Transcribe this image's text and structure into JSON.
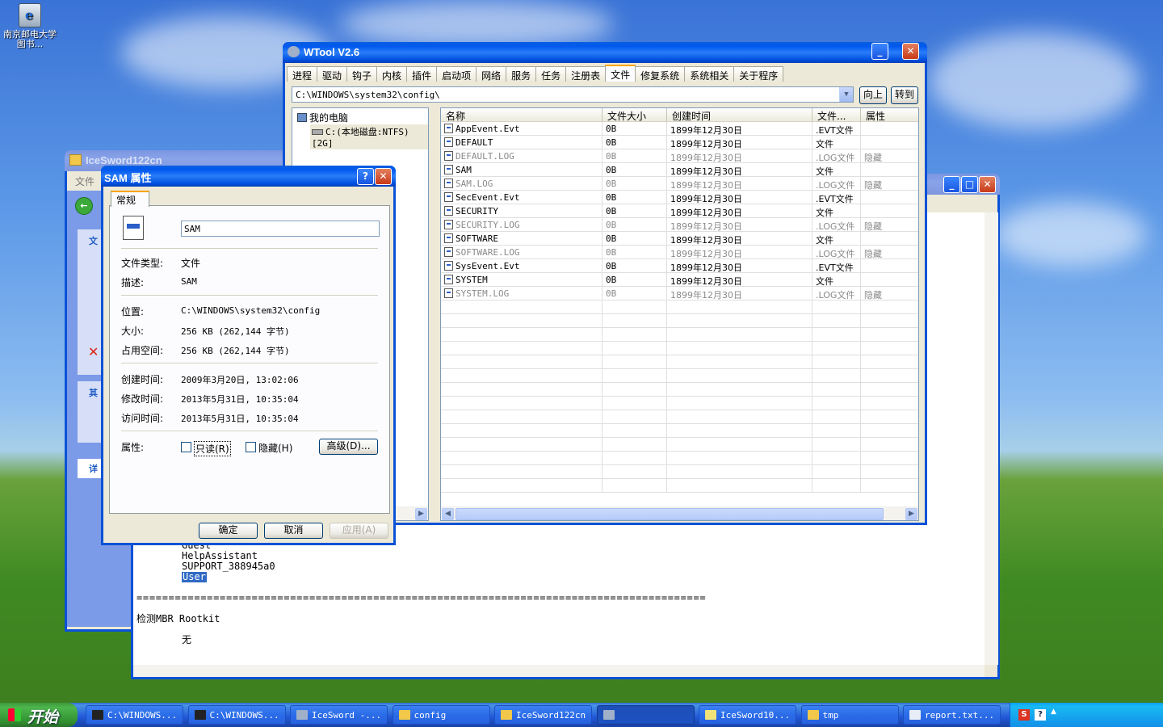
{
  "desktop": {
    "icon_label": "南京邮电大学图书..."
  },
  "wtool": {
    "title": "WTool V2.6",
    "tabs": [
      "进程",
      "驱动",
      "钩子",
      "内核",
      "插件",
      "启动项",
      "网络",
      "服务",
      "任务",
      "注册表",
      "文件",
      "修复系统",
      "系统相关",
      "关于程序"
    ],
    "selected_tab": "文件",
    "path": "C:\\WINDOWS\\system32\\config\\",
    "up_button": "向上",
    "goto_button": "转到",
    "tree": {
      "root": "我的电脑",
      "child": "C:(本地磁盘:NTFS)[2G]"
    },
    "columns": [
      "名称",
      "文件大小",
      "创建时间",
      "文件...",
      "属性"
    ],
    "files": [
      {
        "name": "AppEvent.Evt",
        "size": "0B",
        "created": "1899年12月30日",
        "type": ".EVT文件",
        "attr": "",
        "hidden": false
      },
      {
        "name": "DEFAULT",
        "size": "0B",
        "created": "1899年12月30日",
        "type": "文件",
        "attr": "",
        "hidden": false
      },
      {
        "name": "DEFAULT.LOG",
        "size": "0B",
        "created": "1899年12月30日",
        "type": ".LOG文件",
        "attr": "隐藏",
        "hidden": true
      },
      {
        "name": "SAM",
        "size": "0B",
        "created": "1899年12月30日",
        "type": "文件",
        "attr": "",
        "hidden": false
      },
      {
        "name": "SAM.LOG",
        "size": "0B",
        "created": "1899年12月30日",
        "type": ".LOG文件",
        "attr": "隐藏",
        "hidden": true
      },
      {
        "name": "SecEvent.Evt",
        "size": "0B",
        "created": "1899年12月30日",
        "type": ".EVT文件",
        "attr": "",
        "hidden": false
      },
      {
        "name": "SECURITY",
        "size": "0B",
        "created": "1899年12月30日",
        "type": "文件",
        "attr": "",
        "hidden": false
      },
      {
        "name": "SECURITY.LOG",
        "size": "0B",
        "created": "1899年12月30日",
        "type": ".LOG文件",
        "attr": "隐藏",
        "hidden": true
      },
      {
        "name": "SOFTWARE",
        "size": "0B",
        "created": "1899年12月30日",
        "type": "文件",
        "attr": "",
        "hidden": false
      },
      {
        "name": "SOFTWARE.LOG",
        "size": "0B",
        "created": "1899年12月30日",
        "type": ".LOG文件",
        "attr": "隐藏",
        "hidden": true
      },
      {
        "name": "SysEvent.Evt",
        "size": "0B",
        "created": "1899年12月30日",
        "type": ".EVT文件",
        "attr": "",
        "hidden": false
      },
      {
        "name": "SYSTEM",
        "size": "0B",
        "created": "1899年12月30日",
        "type": "文件",
        "attr": "",
        "hidden": false
      },
      {
        "name": "SYSTEM.LOG",
        "size": "0B",
        "created": "1899年12月30日",
        "type": ".LOG文件",
        "attr": "隐藏",
        "hidden": true
      }
    ]
  },
  "icesword": {
    "title": "IceSword122cn",
    "menu_partial": "文件",
    "section1": "文",
    "section2": "其",
    "section3": "详"
  },
  "notepad": {
    "lines": [
      "Guest",
      "HelpAssistant",
      "SUPPORT_388945a0"
    ],
    "selected": "User",
    "separator": "=========================================================================================",
    "heading": "检测MBR Rootkit",
    "result": "无"
  },
  "dialog": {
    "title": "SAM 属性",
    "tab": "常规",
    "filename": "SAM",
    "rows": [
      {
        "label": "文件类型:",
        "value": "文件"
      },
      {
        "label": "描述:",
        "value": "SAM"
      },
      {
        "label": "位置:",
        "value": "C:\\WINDOWS\\system32\\config"
      },
      {
        "label": "大小:",
        "value": "256 KB (262,144 字节)"
      },
      {
        "label": "占用空间:",
        "value": "256 KB (262,144 字节)"
      },
      {
        "label": "创建时间:",
        "value": "2009年3月20日, 13:02:06"
      },
      {
        "label": "修改时间:",
        "value": "2013年5月31日, 10:35:04"
      },
      {
        "label": "访问时间:",
        "value": "2013年5月31日, 10:35:04"
      }
    ],
    "attr_label": "属性:",
    "readonly_label": "只读(R)",
    "hidden_label": "隐藏(H)",
    "advanced_button": "高级(D)...",
    "ok": "确定",
    "cancel": "取消",
    "apply": "应用(A)"
  },
  "taskbar": {
    "start": "开始",
    "tasks": [
      "C:\\WINDOWS...",
      "C:\\WINDOWS...",
      "IceSword -...",
      "config",
      "IceSword122cn",
      "",
      "IceSword10...",
      "tmp",
      "report.txt..."
    ],
    "active_index": 5
  },
  "colors": {
    "xp_blue": "#0a52d6",
    "taskbar": "#2157d7",
    "start_green": "#3c9a3c",
    "hidden_text": "#8a8a8a",
    "selection": "#316ac5"
  }
}
